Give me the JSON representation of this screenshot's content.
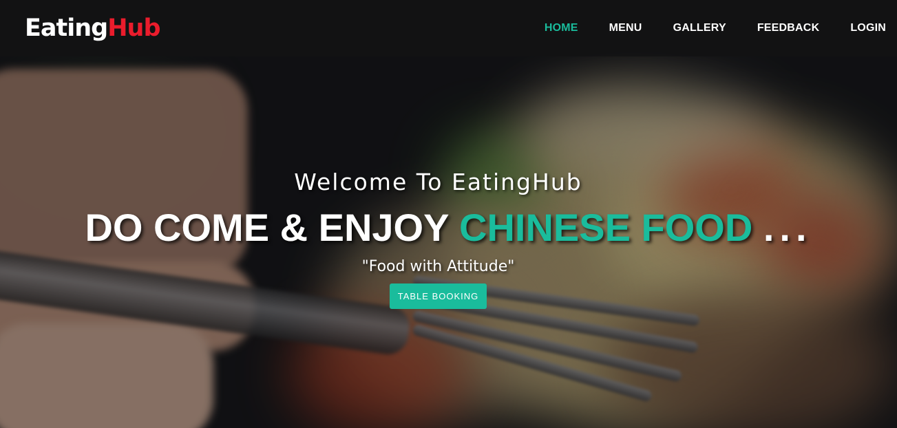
{
  "brand": {
    "part1": "Eating",
    "part2": "Hub"
  },
  "nav": {
    "items": [
      {
        "label": "HOME",
        "active": true
      },
      {
        "label": "MENU",
        "active": false
      },
      {
        "label": "GALLERY",
        "active": false
      },
      {
        "label": "FEEDBACK",
        "active": false
      },
      {
        "label": "LOGIN",
        "active": false
      }
    ]
  },
  "hero": {
    "welcome": "Welcome To EatingHub",
    "headline_main": "DO COME & ENJOY",
    "headline_accent": "CHINESE FOOD",
    "headline_suffix": "...",
    "tagline": "\"Food with Attitude\"",
    "button_label": "TABLE BOOKING"
  },
  "colors": {
    "accent": "#1abc9c",
    "brand_red": "#ea1c2c",
    "nav_bg": "#121214"
  }
}
